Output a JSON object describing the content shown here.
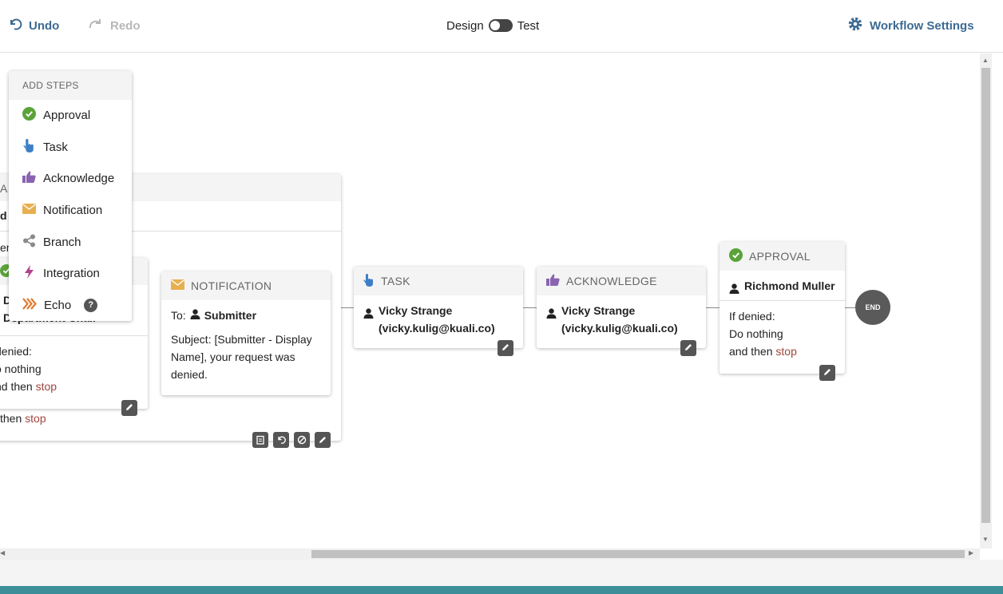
{
  "toolbar": {
    "undo_label": "Undo",
    "redo_label": "Redo",
    "design_label": "Design",
    "test_label": "Test",
    "settings_label": "Workflow Settings"
  },
  "add_steps": {
    "header": "ADD STEPS",
    "items": [
      {
        "label": "Approval",
        "icon": "check-circle-icon",
        "color": "#5aa33a"
      },
      {
        "label": "Task",
        "icon": "hand-pointer-icon",
        "color": "#3d7fc4"
      },
      {
        "label": "Acknowledge",
        "icon": "thumbs-up-icon",
        "color": "#8a63b0"
      },
      {
        "label": "Notification",
        "icon": "envelope-icon",
        "color": "#e6b04f"
      },
      {
        "label": "Branch",
        "icon": "share-icon",
        "color": "#8a8a8a"
      },
      {
        "label": "Integration",
        "icon": "bolt-icon",
        "color": "#b3438c"
      },
      {
        "label": "Echo",
        "icon": "chevrons-right-icon",
        "color": "#e07a2e",
        "help": "?"
      }
    ]
  },
  "group": {
    "head_fragment": "A",
    "sub_fragment": "d",
    "left_text_fragment": "eni",
    "inner_approval": {
      "line1_fragment": "D",
      "line2_fragment": "Department Chair",
      "denied": "denied:",
      "action": "o nothing",
      "then_prefix": "nd then",
      "stop": "stop"
    },
    "then_prefix": "then",
    "stop": "stop"
  },
  "notification_card": {
    "title": "NOTIFICATION",
    "to_label": "To:",
    "to_value": "Submitter",
    "subject_text": "Subject: [Submitter - Display Name], your request was denied."
  },
  "task_card": {
    "title": "TASK",
    "person": "Vicky Strange (vicky.kulig@kuali.co)"
  },
  "acknowledge_card": {
    "title": "ACKNOWLEDGE",
    "person": "Vicky Strange (vicky.kulig@kuali.co)"
  },
  "approval_card": {
    "title": "APPROVAL",
    "person": "Richmond Muller",
    "denied": "If denied:",
    "action": "Do nothing",
    "then_prefix": "and then",
    "stop": "stop"
  },
  "end_label": "END",
  "colors": {
    "accent": "#3d6a93",
    "stop": "#a0463c",
    "footer": "#3c8f99"
  }
}
